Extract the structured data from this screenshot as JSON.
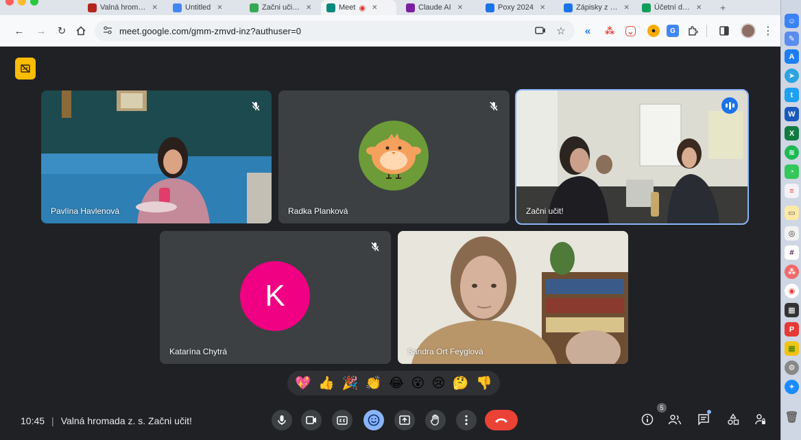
{
  "browser": {
    "tabs": [
      {
        "label": "Valná hrom…",
        "color": "#b3261e"
      },
      {
        "label": "Untitled",
        "color": "#4285f4"
      },
      {
        "label": "Začni uči…",
        "color": "#34a853"
      },
      {
        "label": "Meet",
        "color": "#00897b"
      },
      {
        "label": "Claude AI",
        "color": "#7b1fa2"
      },
      {
        "label": "Poxy 2024",
        "color": "#1a73e8"
      },
      {
        "label": "Zápisky z …",
        "color": "#1a73e8"
      },
      {
        "label": "Účetní d…",
        "color": "#0f9d58"
      }
    ],
    "url": "meet.google.com/gmm-zmvd-inz?authuser=0"
  },
  "participants": [
    {
      "name": "Pavlína Havlenová",
      "muted": true
    },
    {
      "name": "Radka Planková",
      "muted": true
    },
    {
      "name": "Začni učit!",
      "speaking": true
    },
    {
      "name": "Katarína Chytrá",
      "muted": true,
      "initial": "K"
    },
    {
      "name": "Sandra Ort Feyglová"
    }
  ],
  "reactions": [
    "💖",
    "👍",
    "🎉",
    "👏",
    "😂",
    "😮",
    "😢",
    "🤔",
    "👎"
  ],
  "meeting": {
    "time": "10:45",
    "separator": "|",
    "title": "Valná hromada z. s. Začni učit!",
    "people_count": "5"
  },
  "colors": {
    "accent": "#8ab4f8",
    "end_call": "#ea4335",
    "background": "#202124",
    "tile": "#3c4043"
  }
}
